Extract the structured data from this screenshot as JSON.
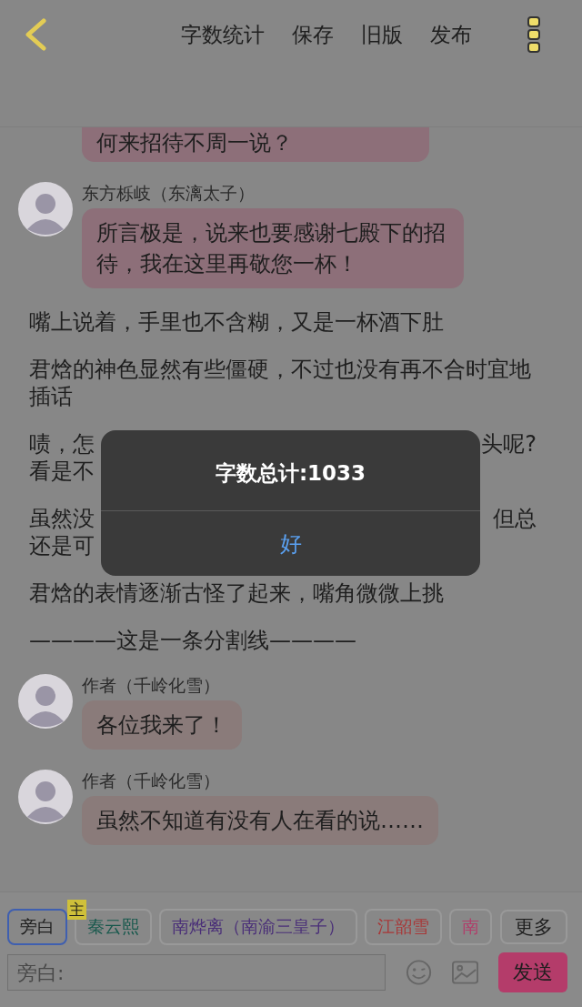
{
  "toolbar": {
    "actions": [
      "字数统计",
      "保存",
      "旧版",
      "发布"
    ]
  },
  "messages": [
    {
      "kind": "bubble_tail",
      "text": "何来招待不周一说？",
      "color": "#8d6f79"
    },
    {
      "kind": "bubble",
      "speaker": "东方栎岐（东漓太子）",
      "text": "所言极是，说来也要感谢七殿下的招待，我在这里再敬您一杯！",
      "color": "#8d6f79"
    },
    {
      "kind": "narration",
      "text": "嘴上说着，手里也不含糊，又是一杯酒下肚"
    },
    {
      "kind": "narration",
      "text": "君焓的神色显然有些僵硬，不过也没有再不合时宜地插话"
    },
    {
      "kind": "covered",
      "lines": [
        {
          "left": "啧，怎",
          "right": "头呢?"
        },
        {
          "left": "看是不"
        }
      ]
    },
    {
      "kind": "covered",
      "lines": [
        {
          "left": "虽然没",
          "right": "但总"
        },
        {
          "left": "还是可"
        }
      ]
    },
    {
      "kind": "narration",
      "text": "君焓的表情逐渐古怪了起来，嘴角微微上挑"
    },
    {
      "kind": "narration",
      "text": "————这是一条分割线————"
    },
    {
      "kind": "bubble",
      "speaker": "作者（千岭化雪）",
      "text": "各位我来了！",
      "color": "#8a7b7a"
    },
    {
      "kind": "bubble",
      "speaker": "作者（千岭化雪）",
      "text": "虽然不知道有没有人在看的说……",
      "color": "#8a7b7a"
    }
  ],
  "speakers": [
    {
      "label": "旁白",
      "color": "#1e1e1e",
      "selected": true
    },
    {
      "label": "秦云熙",
      "color": "#16584c",
      "selected": false,
      "badge": "主"
    },
    {
      "label": "南烨离（南渝三皇子）",
      "color": "#4a2f78",
      "selected": false
    },
    {
      "label": "江韶雪",
      "color": "#a83838",
      "selected": false
    },
    {
      "label": "南",
      "color": "#b03e6a",
      "selected": false
    }
  ],
  "more_button": "更多",
  "input": {
    "placeholder": "旁白:"
  },
  "send_button": "发送",
  "dialog": {
    "title": "字数总计:1033",
    "button": "好"
  }
}
